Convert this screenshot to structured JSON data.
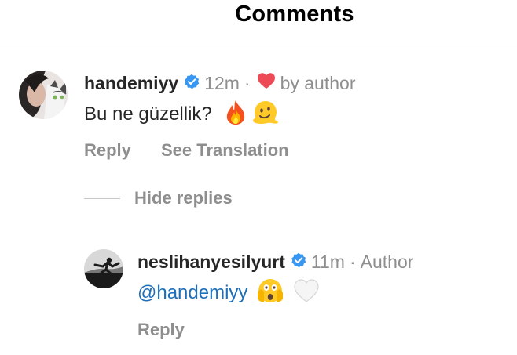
{
  "header": {
    "title": "Comments"
  },
  "comment": {
    "username": "handemiyy",
    "time": "12m",
    "separator": "·",
    "liked_by": "by author",
    "text": "Bu ne güzellik?",
    "reply_label": "Reply",
    "translate_label": "See Translation",
    "hide_replies_label": "Hide replies"
  },
  "reply": {
    "username": "neslihanyesilyurt",
    "time": "11m",
    "separator": "·",
    "author_badge": "Author",
    "mention": "@handemiyy",
    "reply_label": "Reply"
  },
  "colors": {
    "verified": "#3897f0",
    "heart": "#ed4956",
    "mention": "#1e6fb8",
    "muted": "#8e8e8e"
  },
  "icons": [
    "verified-badge-icon",
    "heart-icon",
    "fire-emoji",
    "melting-face-emoji",
    "shocked-face-emoji",
    "white-heart-emoji"
  ]
}
